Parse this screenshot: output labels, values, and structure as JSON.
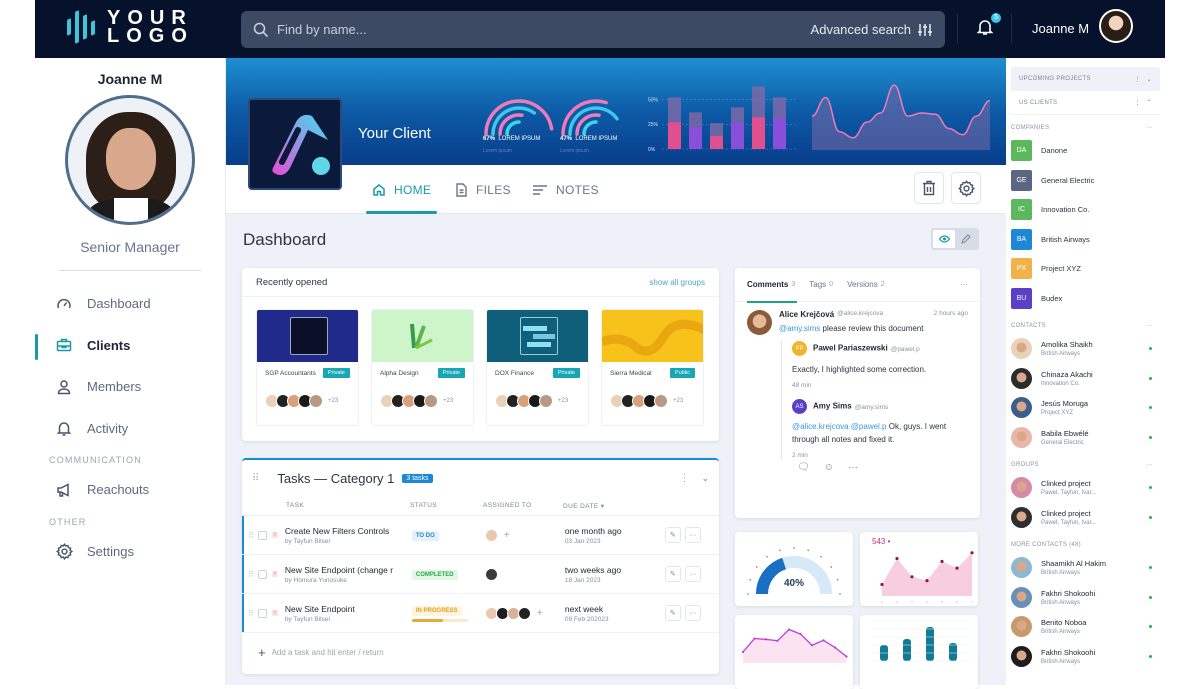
{
  "topbar": {
    "logo": {
      "line1": "YOUR",
      "line2": "LOGO"
    },
    "search": {
      "placeholder": "Find by name...",
      "value": ""
    },
    "advanced_search_label": "Advanced search",
    "notification_count": "5",
    "user_name": "Joanne M"
  },
  "sidebar": {
    "user_name": "Joanne M",
    "role": "Senior Manager",
    "items": [
      {
        "label": "Dashboard",
        "icon": "gauge-icon",
        "active": false
      },
      {
        "label": "Clients",
        "icon": "briefcase-icon",
        "active": true
      },
      {
        "label": "Members",
        "icon": "user-icon",
        "active": false
      },
      {
        "label": "Activity",
        "icon": "bell-icon",
        "active": false
      }
    ],
    "sections": [
      {
        "title": "COMMUNICATION",
        "items": [
          {
            "label": "Reachouts",
            "icon": "megaphone-icon"
          }
        ]
      },
      {
        "title": "OTHER",
        "items": [
          {
            "label": "Settings",
            "icon": "gear-icon"
          }
        ]
      }
    ]
  },
  "hero": {
    "client_name": "Your Client",
    "gauges": [
      {
        "value": "67%",
        "label": "LOREM IPSUM",
        "sub": "Lorem ipsum"
      },
      {
        "value": "47%",
        "label": "LOREM IPSUM",
        "sub": "Lorem ipsum"
      }
    ],
    "bar_chart": {
      "y_ticks": [
        "50%",
        "25%",
        "0%"
      ],
      "bars": [
        {
          "total": 0.52,
          "highlight": 0.27,
          "color": "#e0508f"
        },
        {
          "total": 0.37,
          "highlight": 0.22,
          "color": "#8a4fd8"
        },
        {
          "total": 0.26,
          "highlight": 0.13,
          "color": "#e0508f"
        },
        {
          "total": 0.42,
          "highlight": 0.26,
          "color": "#8a4fd8"
        },
        {
          "total": 0.63,
          "highlight": 0.32,
          "color": "#e0508f"
        },
        {
          "total": 0.52,
          "highlight": 0.31,
          "color": "#8a4fd8"
        }
      ]
    },
    "wave_values": [
      0.45,
      0.75,
      0.2,
      0.1,
      0.35,
      0.5,
      0.95,
      0.45,
      0.5,
      0.48,
      0.25,
      0.15,
      0.45,
      0.7
    ]
  },
  "tabs": [
    {
      "label": "HOME",
      "icon": "home-icon",
      "active": true
    },
    {
      "label": "FILES",
      "icon": "file-icon",
      "active": false
    },
    {
      "label": "NOTES",
      "icon": "notes-icon",
      "active": false
    }
  ],
  "page_title": "Dashboard",
  "recent": {
    "title": "Recently opened",
    "link": "show all groups",
    "items": [
      {
        "name": "SGP Accountants",
        "visibility": "Private",
        "extra": "+23",
        "bg": "#1f2a8a"
      },
      {
        "name": "Alpha Design",
        "visibility": "Private",
        "extra": "+23",
        "bg": "#cdf5c9"
      },
      {
        "name": "DOX Finance",
        "visibility": "Private",
        "extra": "+23",
        "bg": "#0f5f7a"
      },
      {
        "name": "Sierra Medical",
        "visibility": "Public",
        "extra": "+23",
        "bg": "#f7c21a"
      }
    ]
  },
  "tasks": {
    "title": "Tasks — Category 1",
    "count_badge": "3 tasks",
    "columns": [
      "TASK",
      "STATUS",
      "ASSIGNED TO",
      "DUE DATE"
    ],
    "rows": [
      {
        "name": "Create New Filters Controls",
        "by": "by  Tayfun Bilsel",
        "status": "TO DO",
        "status_color": "#2a86c9",
        "status_bg": "#e3f1fb",
        "due": "one month ago",
        "date": "03 Jan 2023"
      },
      {
        "name": "New Site Endpoint (change r",
        "by": "by  Homura Yunosuke",
        "status": "COMPLETED",
        "status_color": "#2aa84a",
        "status_bg": "#e3f7e7",
        "due": "two weeks ago",
        "date": "18 Jan 2023"
      },
      {
        "name": "New Site Endpoint",
        "by": "by  Tayfun Bilsel",
        "status": "IN PROGRESS",
        "status_color": "#e0a020",
        "status_bg": "#fff5df",
        "due": "next week",
        "date": "09 Feb 202023",
        "progress": 0.55
      }
    ],
    "add_placeholder": "Add a task and hit enter / return"
  },
  "comments": {
    "tabs": [
      {
        "label": "Comments",
        "count": "3",
        "active": true
      },
      {
        "label": "Tags",
        "count": "0",
        "active": false
      },
      {
        "label": "Versions",
        "count": "2",
        "active": false
      }
    ],
    "main": {
      "author": "Alice Krejčová",
      "handle": "@alice.krejcova",
      "time": "2 hours ago",
      "mention": "@amy.sims",
      "text": " please review this document"
    },
    "replies": [
      {
        "initials": "PP",
        "color": "#f2b22a",
        "author": "Pawel Pariaszewski",
        "handle": "@pawel.p",
        "mentions": "",
        "text": "Exactly, I highlighted some correction.",
        "time": "48 min"
      },
      {
        "initials": "AS",
        "color": "#5a3fc8",
        "author": "Amy Sims",
        "handle": "@amy.sims",
        "mentions": "@alice.krejcova @pawel.p",
        "text": " Ok, guys. I went through all notes and fixed it.",
        "time": "2 min"
      }
    ]
  },
  "widgets": {
    "gauge": {
      "value": 0.4,
      "label": "40%"
    },
    "area": {
      "headline": "543",
      "values": [
        120,
        390,
        200,
        160,
        360,
        290,
        450
      ],
      "ymax": 500
    },
    "line": {
      "values": [
        2,
        5,
        4.8,
        4.5,
        7,
        6,
        3.5,
        4.6,
        3,
        1
      ]
    },
    "bars": {
      "values": [
        40,
        55,
        85,
        45
      ],
      "ymax": 100
    }
  },
  "rightbar": {
    "upcoming": "UPCOMING PROJECTS",
    "us_clients": "US CLIENTS",
    "companies_title": "COMPANIES",
    "companies": [
      {
        "initials": "DA",
        "name": "Danone",
        "color": "#5cb85c"
      },
      {
        "initials": "GE",
        "name": "General Electric",
        "color": "#5b6782"
      },
      {
        "initials": "IC",
        "name": "Innovation Co.",
        "color": "#5cb85c"
      },
      {
        "initials": "BA",
        "name": "British Airways",
        "color": "#1e88d6"
      },
      {
        "initials": "PX",
        "name": "Project XYZ",
        "color": "#f2b24a"
      },
      {
        "initials": "BU",
        "name": "Budex",
        "color": "#5a3fc8"
      }
    ],
    "contacts_title": "CONTACTS",
    "contacts": [
      {
        "name": "Amolika Shaikh",
        "org": "British Airways",
        "av": "#e9d2b8"
      },
      {
        "name": "Chinaza Akachi",
        "org": "Innovation Co.",
        "av": "#2b2b2b"
      },
      {
        "name": "Jesús Moruga",
        "org": "Project XYZ",
        "av": "#3b5e8a"
      },
      {
        "name": "Babila Ebwélé",
        "org": "General Electric",
        "av": "#e8b7a8"
      }
    ],
    "groups_title": "GROUPS",
    "groups": [
      {
        "name": "Clinked project",
        "org": "Pawel, Tayfun, Ivar...",
        "av": "#d58aa8"
      },
      {
        "name": "Clinked project",
        "org": "Pawel, Tayfun, Ivar...",
        "av": "#2e2e2e"
      }
    ],
    "more_title": "MORE CONTACTS (48)",
    "more": [
      {
        "name": "Shaamikh Al Hakim",
        "org": "British Airways",
        "av": "#8fb7d0"
      },
      {
        "name": "Fakhri Shokoohi",
        "org": "British Airways",
        "av": "#6a8fb8"
      },
      {
        "name": "Benito Noboa",
        "org": "British Airways",
        "av": "#c89a6a"
      },
      {
        "name": "Fakhri Shokoohi",
        "org": "British Airways",
        "av": "#1d1d1d"
      }
    ]
  }
}
